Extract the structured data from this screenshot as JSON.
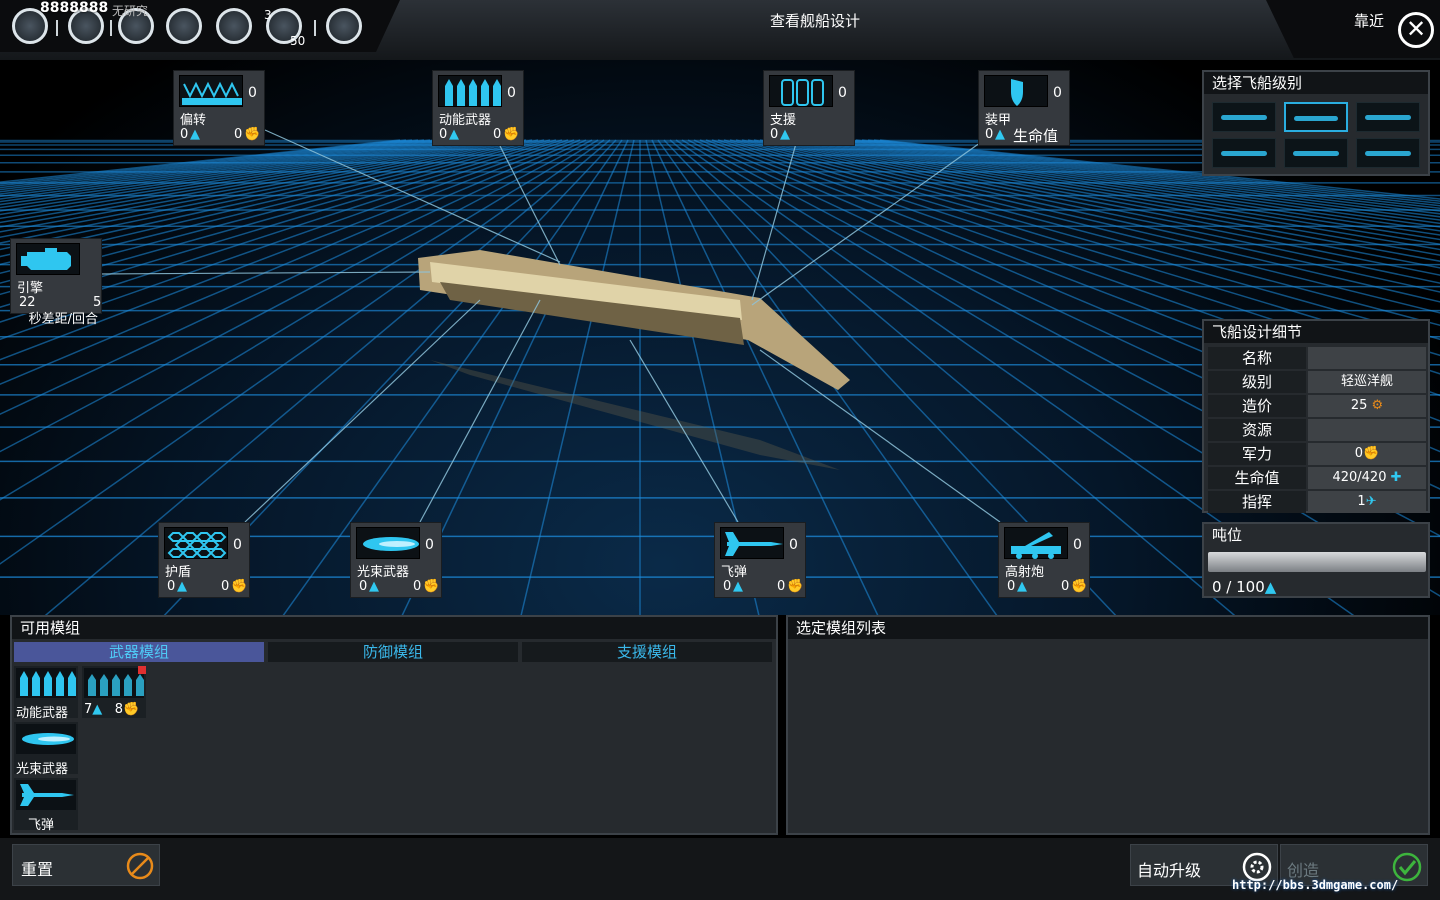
{
  "topbar": {
    "credits": "8888888",
    "research_label": "无研究",
    "badge_top": "3",
    "badge_bottom": "50",
    "screen_title": "查看舰船设计",
    "close_label": "靠近",
    "close_symbol": "✕",
    "icons": [
      "galaxy-icon",
      "empire-icon",
      "research-icon",
      "planets-icon",
      "diplomacy-icon",
      "population-icon",
      "settings-icon"
    ]
  },
  "slots": [
    {
      "id": "deflector",
      "name": "偏转",
      "count": "0",
      "left": "0",
      "right": "0"
    },
    {
      "id": "kinetic",
      "name": "动能武器",
      "count": "0",
      "left": "0",
      "right": "0"
    },
    {
      "id": "support",
      "name": "支援",
      "count": "0",
      "left": "0",
      "right": ""
    },
    {
      "id": "armor",
      "name": "装甲",
      "count": "0",
      "left": "0",
      "right": "生命值"
    },
    {
      "id": "engine",
      "name": "引擎",
      "count": "",
      "left": "22",
      "right": "5",
      "extra": "秒差距/回合"
    },
    {
      "id": "shield",
      "name": "护盾",
      "count": "0",
      "left": "0",
      "right": "0"
    },
    {
      "id": "beam",
      "name": "光束武器",
      "count": "0",
      "left": "0",
      "right": "0"
    },
    {
      "id": "missile",
      "name": "飞弹",
      "count": "0",
      "left": "0",
      "right": "0"
    },
    {
      "id": "artillery",
      "name": "高射炮",
      "count": "0",
      "left": "0",
      "right": "0"
    }
  ],
  "ship_class": {
    "title": "选择飞船级别",
    "selected_index": 1
  },
  "details": {
    "title": "飞船设计细节",
    "rows": [
      {
        "label": "名称",
        "value": ""
      },
      {
        "label": "级别",
        "value": "轻巡洋舰"
      },
      {
        "label": "造价",
        "value": "25"
      },
      {
        "label": "资源",
        "value": ""
      },
      {
        "label": "军力",
        "value": "0"
      },
      {
        "label": "生命值",
        "value": "420/420"
      },
      {
        "label": "指挥",
        "value": "1"
      }
    ]
  },
  "tonnage": {
    "title": "吨位",
    "text": "0 / 100",
    "fraction": 0
  },
  "modules": {
    "title": "可用模组",
    "tabs": [
      "武器模组",
      "防御模组",
      "支援模组"
    ],
    "active_tab": 0,
    "items": [
      {
        "name": "动能武器"
      },
      {
        "name": "",
        "left": "7",
        "right": "8"
      },
      {
        "name": "光束武器"
      },
      {
        "name": "飞弹"
      }
    ]
  },
  "selected_list": {
    "title": "选定模组列表"
  },
  "bottom": {
    "reset": "重置",
    "auto_upgrade": "自动升级",
    "create": "创造",
    "watermark": "http://bbs.3dmgame.com/"
  },
  "colors": {
    "accent": "#2fc6f0",
    "tab_active": "#4a569a",
    "grid": "#1d8ee0",
    "ok": "#3db43d",
    "danger": "#e88a1a"
  }
}
